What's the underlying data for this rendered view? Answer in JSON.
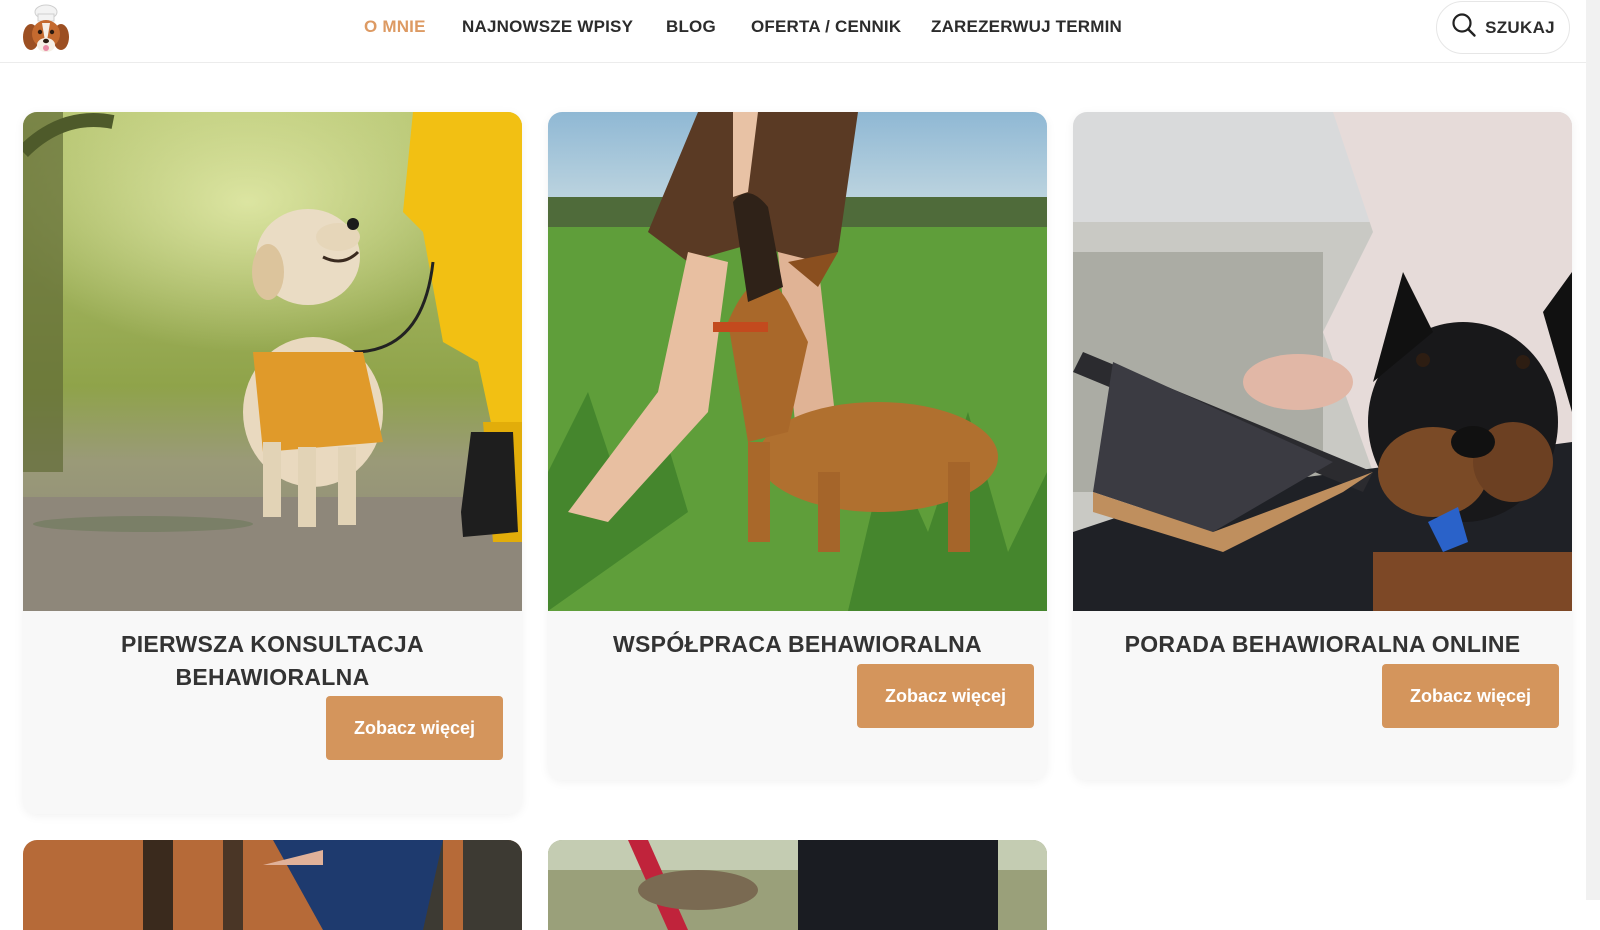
{
  "nav": {
    "items": [
      {
        "label": "O MNIE",
        "active": true
      },
      {
        "label": "NAJNOWSZE WPISY"
      },
      {
        "label": "BLOG"
      },
      {
        "label": "OFERTA / CENNIK"
      },
      {
        "label": "ZAREZERWUJ TERMIN"
      }
    ],
    "search_label": "SZUKAJ"
  },
  "cards": [
    {
      "title": "PIERWSZA KONSULTACJA BEHAWIORALNA",
      "button": "Zobacz więcej"
    },
    {
      "title": "WSPÓŁPRACA BEHAWIORALNA",
      "button": "Zobacz więcej"
    },
    {
      "title": "PORADA BEHAWIORALNA ONLINE",
      "button": "Zobacz więcej"
    }
  ],
  "colors": {
    "accent": "#d4955c",
    "active_nav": "#dd9a63",
    "card_bg": "#f8f8f8"
  }
}
